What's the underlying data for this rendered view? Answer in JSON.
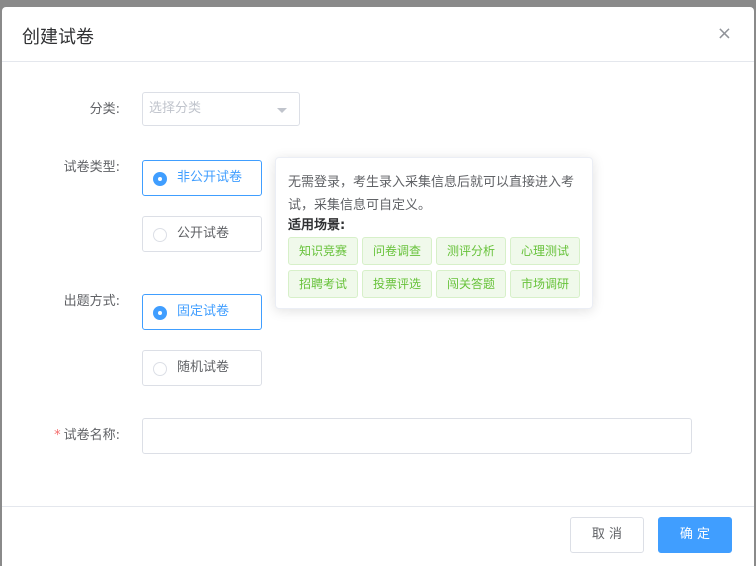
{
  "dialog": {
    "title": "创建试卷",
    "close_symbol": "×"
  },
  "form": {
    "category": {
      "label": "分类:",
      "placeholder": "选择分类"
    },
    "paper_type": {
      "label": "试卷类型:",
      "options": [
        {
          "label": "非公开试卷",
          "checked": true
        },
        {
          "label": "公开试卷",
          "checked": false
        }
      ]
    },
    "question_mode": {
      "label": "出题方式:",
      "options": [
        {
          "label": "固定试卷",
          "checked": true
        },
        {
          "label": "随机试卷",
          "checked": false
        }
      ]
    },
    "paper_name": {
      "required_mark": "*",
      "label": "试卷名称:",
      "value": ""
    }
  },
  "tooltip": {
    "description": "无需登录，考生录入采集信息后就可以直接进入考试，采集信息可自定义。",
    "scenarios_label": "适用场景:",
    "tags": [
      "知识竞赛",
      "问卷调查",
      "测评分析",
      "心理测试",
      "招聘考试",
      "投票评选",
      "闯关答题",
      "市场调研"
    ]
  },
  "footer": {
    "cancel_label": "取 消",
    "confirm_label": "确 定"
  },
  "colors": {
    "primary": "#409eff",
    "tag_green": "#67c23a",
    "required": "#f56c6c"
  }
}
